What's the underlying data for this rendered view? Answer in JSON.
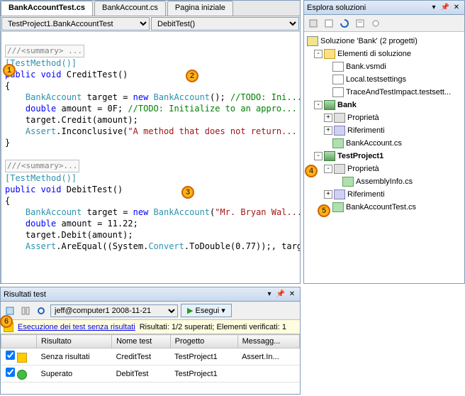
{
  "tabs": {
    "t0": "BankAccountTest.cs",
    "t1": "BankAccount.cs",
    "t2": "Pagina iniziale"
  },
  "nav": {
    "class": "TestProject1.BankAccountTest",
    "method": "DebitTest()"
  },
  "code": {
    "l1": "///<summary> ...",
    "l2a": "[",
    "l2b": "TestMethod",
    "l2c": "()]",
    "l3a": "public",
    "l3b": " void",
    "l3c": " CreditTest()",
    "l4": "{",
    "l5a": "    ",
    "l5b": "BankAccount",
    "l5c": " target = ",
    "l5d": "new",
    "l5e": " BankAccount",
    "l5f": "(); ",
    "l5g": "//TODO: Ini...",
    "l6a": "    ",
    "l6b": "double",
    "l6c": " amount = 0F; ",
    "l6d": "//TODO: Initialize to an appro...",
    "l7": "    target.Credit(amount);",
    "l8a": "    ",
    "l8b": "Assert",
    "l8c": ".Inconclusive(",
    "l8d": "\"A method that does not return...",
    "l9": "}",
    "l10": "///<summary>...",
    "l11a": "[",
    "l11b": "TestMethod",
    "l11c": "()]",
    "l12a": "public",
    "l12b": " void",
    "l12c": " DebitTest()",
    "l13": "{",
    "l14a": "    ",
    "l14b": "BankAccount",
    "l14c": " target = ",
    "l14d": "new",
    "l14e": " BankAccount",
    "l14f": "(",
    "l14g": "\"Mr. Bryan Wal...",
    "l15a": "    ",
    "l15b": "double",
    "l15c": " amount = 11.22;",
    "l16": "    target.Debit(amount);",
    "l17a": "    ",
    "l17b": "Assert",
    "l17c": ".AreEqual((System.",
    "l17d": "Convert",
    "l17e": ".ToDouble(0.77));, targ..."
  },
  "solution": {
    "title": "Esplora soluzioni",
    "root": "Soluzione 'Bank' (2 progetti)",
    "items_folder": "Elementi di soluzione",
    "f1": "Bank.vsmdi",
    "f2": "Local.testsettings",
    "f3": "TraceAndTestImpact.testsett...",
    "proj1": "Bank",
    "prop": "Proprietà",
    "ref": "Riferimenti",
    "p1f1": "BankAccount.cs",
    "proj2": "TestProject1",
    "p2f1": "AssemblyInfo.cs",
    "p2f2": "BankAccountTest.cs"
  },
  "results": {
    "title": "Risultati test",
    "run_sel": "jeff@computer1 2008-11-21",
    "run_btn": "Esegui",
    "status_link": "Esecuzione dei test senza risultati",
    "status_text": "Risultati: 1/2 superati; Elementi verificati: 1",
    "cols": {
      "c0": "",
      "c1": "Risultato",
      "c2": "Nome test",
      "c3": "Progetto",
      "c4": "Messagg..."
    },
    "rows": [
      {
        "r": "Senza risultati",
        "n": "CreditTest",
        "p": "TestProject1",
        "m": "Assert.In..."
      },
      {
        "r": "Superato",
        "n": "DebitTest",
        "p": "TestProject1",
        "m": ""
      }
    ]
  },
  "badges": {
    "b1": "1",
    "b2": "2",
    "b3": "3",
    "b4": "4",
    "b5": "5",
    "b6": "6"
  }
}
